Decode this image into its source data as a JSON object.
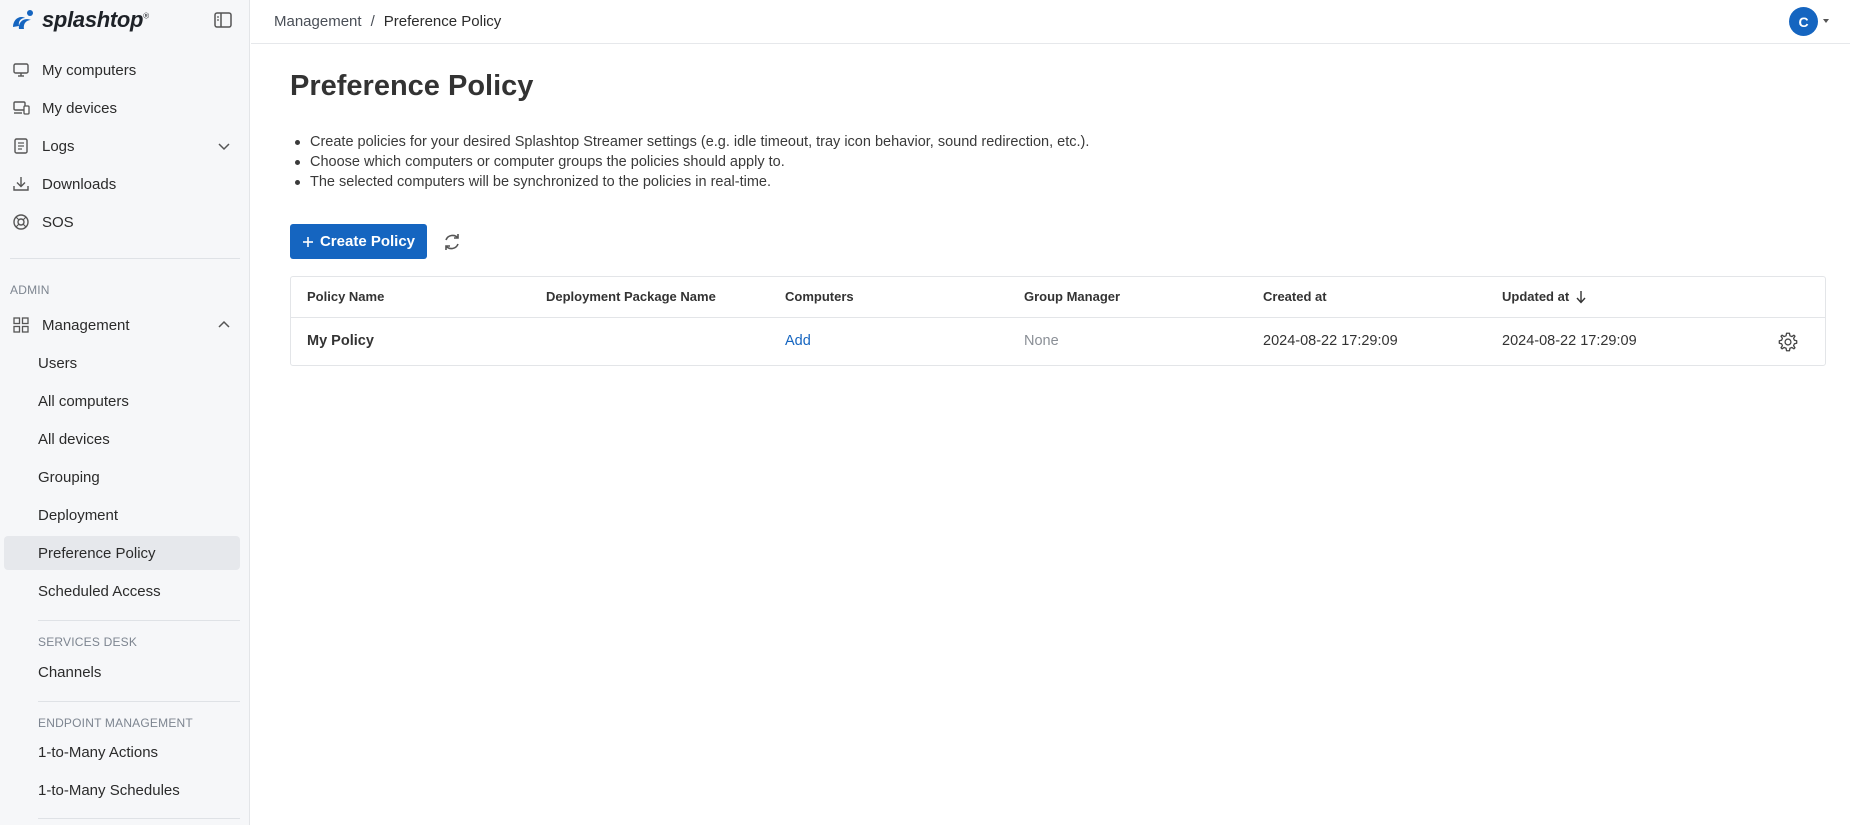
{
  "brand": {
    "name": "splashtop",
    "mark": "®",
    "accent": "#1565c0"
  },
  "sidebar": {
    "items": [
      {
        "label": "My computers",
        "icon": "monitor-icon"
      },
      {
        "label": "My devices",
        "icon": "devices-icon"
      },
      {
        "label": "Logs",
        "icon": "logs-icon"
      },
      {
        "label": "Downloads",
        "icon": "download-icon"
      },
      {
        "label": "SOS",
        "icon": "sos-icon"
      }
    ],
    "admin_label": "ADMIN",
    "management": {
      "label": "Management",
      "icon": "grid-icon",
      "items": [
        {
          "label": "Users"
        },
        {
          "label": "All computers"
        },
        {
          "label": "All devices"
        },
        {
          "label": "Grouping"
        },
        {
          "label": "Deployment"
        },
        {
          "label": "Preference Policy",
          "active": true
        },
        {
          "label": "Scheduled Access"
        }
      ]
    },
    "services_desk_label": "SERVICES DESK",
    "services_desk_items": [
      {
        "label": "Channels"
      }
    ],
    "endpoint_label": "ENDPOINT MANAGEMENT",
    "endpoint_items": [
      {
        "label": "1-to-Many Actions"
      },
      {
        "label": "1-to-Many Schedules"
      }
    ]
  },
  "header": {
    "breadcrumb": {
      "parent": "Management",
      "separator": "/",
      "current": "Preference Policy"
    },
    "avatar_initial": "C"
  },
  "main": {
    "title": "Preference Policy",
    "bullets": [
      "Create policies for your desired Splashtop Streamer settings (e.g. idle timeout, tray icon behavior, sound redirection, etc.).",
      "Choose which computers or computer groups the policies should apply to.",
      "The selected computers will be synchronized to the policies in real-time."
    ],
    "create_button": "Create Policy",
    "table": {
      "columns": [
        "Policy Name",
        "Deployment Package Name",
        "Computers",
        "Group Manager",
        "Created at",
        "Updated at"
      ],
      "sort": {
        "column": "Updated at",
        "direction": "descending"
      },
      "rows": [
        {
          "policy_name": "My Policy",
          "deployment_package": "",
          "computers": "Add",
          "group_manager": "None",
          "created_at": "2024-08-22 17:29:09",
          "updated_at": "2024-08-22 17:29:09"
        }
      ]
    }
  }
}
